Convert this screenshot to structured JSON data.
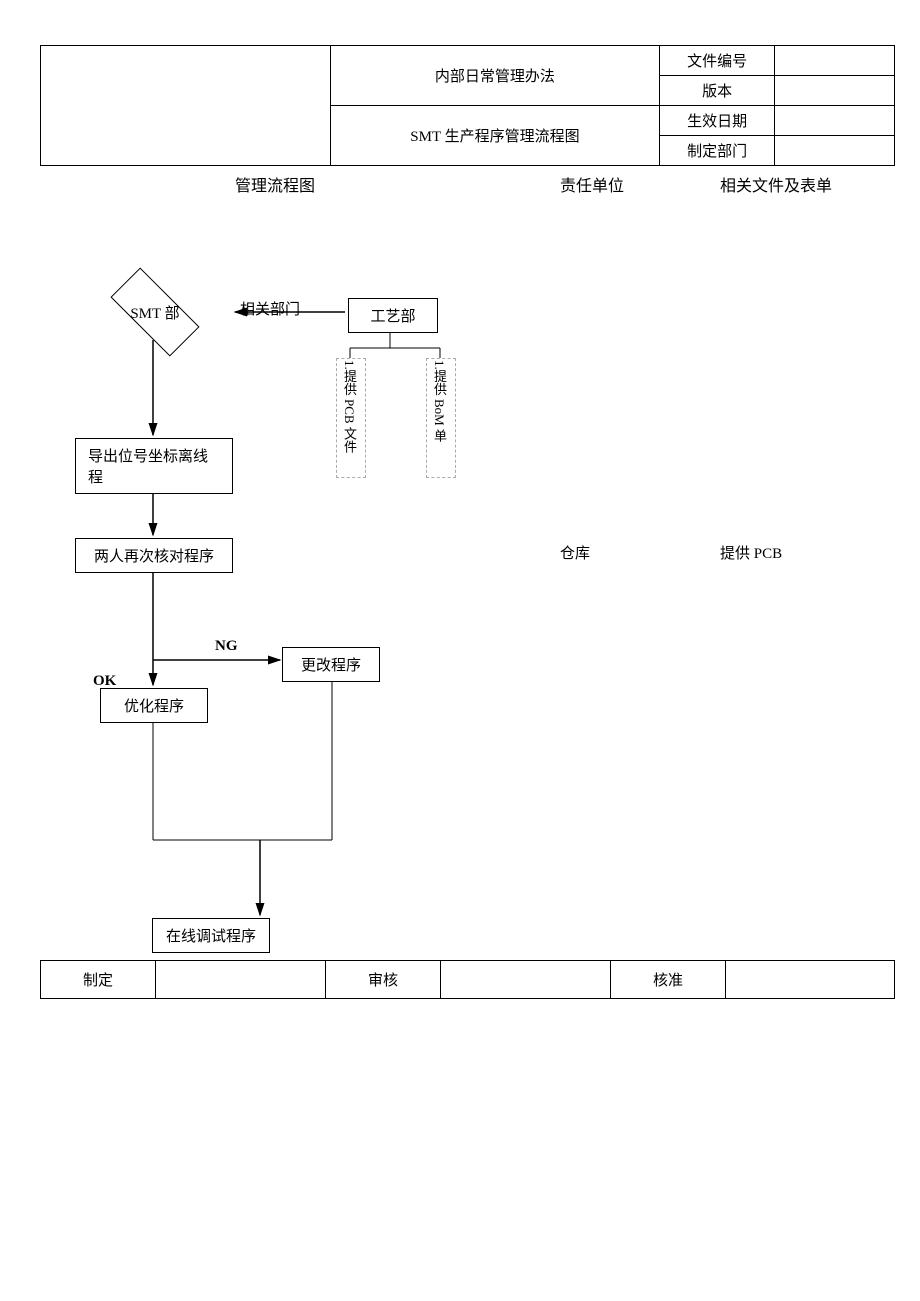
{
  "header": {
    "title": "内部日常管理办法",
    "subtitle": "SMT 生产程序管理流程图",
    "meta": {
      "doc_no_label": "文件编号",
      "version_label": "版本",
      "eff_date_label": "生效日期",
      "dept_label": "制定部门",
      "doc_no": "",
      "version": "",
      "eff_date": "",
      "dept": ""
    }
  },
  "columns": {
    "c1": "管理流程图",
    "c2": "责任单位",
    "c3": "相关文件及表单"
  },
  "flow": {
    "smt_dept": "SMT 部",
    "related_dept": "相关部门",
    "tech_dept": "工艺部",
    "provide_pcb_file": "1.提供 PCB 文件",
    "provide_bom": "1.提供 BoM 单",
    "export_coords": "导出位号坐标离线程",
    "recheck": "两人再次核对程序",
    "ng": "NG",
    "ok": "OK",
    "change_prog": "更改程序",
    "optimize": "优化程序",
    "online_debug": "在线调试程序",
    "warehouse": "仓库",
    "provide_pcb": "提供 PCB"
  },
  "footer": {
    "create": "制定",
    "review": "审核",
    "approve": "核准",
    "create_val": "",
    "review_val": "",
    "approve_val": ""
  }
}
